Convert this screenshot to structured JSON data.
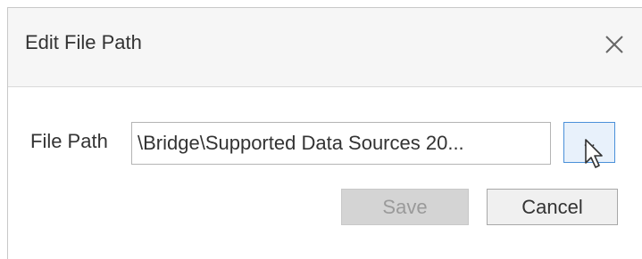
{
  "dialog": {
    "title": "Edit File Path",
    "close_icon": "close-icon"
  },
  "form": {
    "field_label": "File Path",
    "file_path_value": "\\Bridge\\Supported Data Sources 20...",
    "browse_label": "..."
  },
  "actions": {
    "save_label": "Save",
    "save_disabled": true,
    "cancel_label": "Cancel"
  },
  "colors": {
    "header_bg": "#f6f6f6",
    "browse_bg": "#e8f1fb",
    "browse_border": "#4a90d9",
    "disabled_bg": "#d4d4d4"
  }
}
